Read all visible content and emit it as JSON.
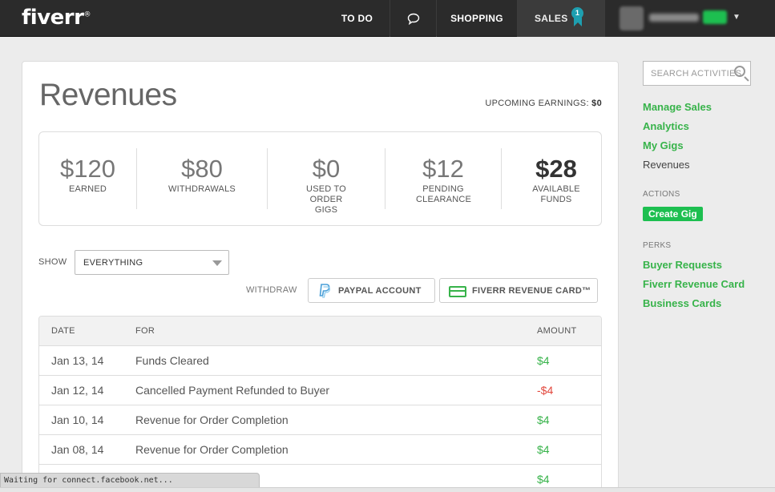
{
  "header": {
    "logo": "fiverr",
    "logo_reg": "®",
    "nav": {
      "todo": "TO DO",
      "shopping": "SHOPPING",
      "sales": "SALES",
      "sales_badge": "1"
    }
  },
  "page": {
    "title": "Revenues",
    "upcoming_label": "UPCOMING EARNINGS:",
    "upcoming_value": "$0"
  },
  "stats": [
    {
      "value": "$120",
      "label": "EARNED"
    },
    {
      "value": "$80",
      "label": "WITHDRAWALS"
    },
    {
      "value": "$0",
      "label": "USED TO ORDER GIGS"
    },
    {
      "value": "$12",
      "label": "PENDING CLEARANCE"
    },
    {
      "value": "$28",
      "label": "AVAILABLE FUNDS"
    }
  ],
  "filter": {
    "label": "SHOW",
    "selected": "EVERYTHING"
  },
  "withdraw": {
    "label": "WITHDRAW",
    "paypal": "PAYPAL ACCOUNT",
    "card": "FIVERR REVENUE CARD™"
  },
  "table": {
    "headers": {
      "date": "DATE",
      "for": "FOR",
      "amount": "AMOUNT"
    },
    "rows": [
      {
        "date": "Jan 13, 14",
        "for": "Funds Cleared",
        "amount": "$4"
      },
      {
        "date": "Jan 12, 14",
        "for": "Cancelled Payment Refunded to Buyer",
        "amount": "-$4"
      },
      {
        "date": "Jan 10, 14",
        "for": "Revenue for Order Completion",
        "amount": "$4"
      },
      {
        "date": "Jan 08, 14",
        "for": "Revenue for Order Completion",
        "amount": "$4"
      },
      {
        "date": "",
        "for": "",
        "amount": "$4"
      }
    ]
  },
  "sidebar": {
    "search_placeholder": "SEARCH ACTIVITIES",
    "links": [
      "Manage Sales",
      "Analytics",
      "My Gigs",
      "Revenues"
    ],
    "actions_heading": "ACTIONS",
    "create_gig": "Create Gig",
    "perks_heading": "PERKS",
    "perks": [
      "Buyer Requests",
      "Fiverr Revenue Card",
      "Business Cards"
    ]
  },
  "status_bar": "Waiting for connect.facebook.net..."
}
